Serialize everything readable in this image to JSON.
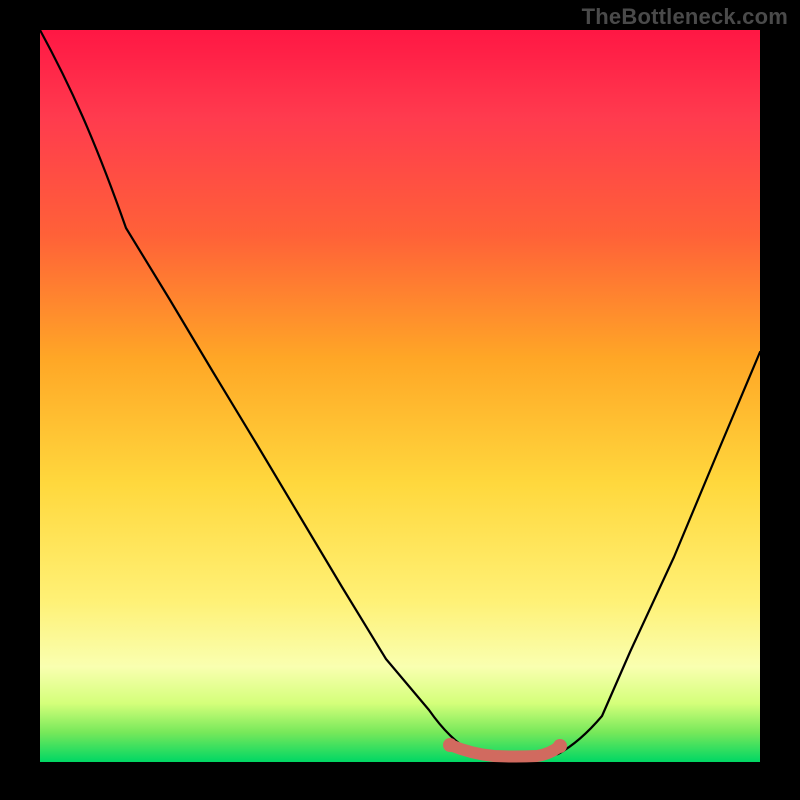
{
  "watermark": "TheBottleneck.com",
  "colors": {
    "background": "#000000",
    "watermark_text": "#4a4a4a",
    "curve_stroke": "#000000",
    "optimal_marker": "#d16a5f",
    "gradient_top": "#ff1744",
    "gradient_mid1": "#ffa726",
    "gradient_mid2": "#ffd83d",
    "gradient_bottom": "#00d764"
  },
  "chart_data": {
    "type": "line",
    "title": "",
    "xlabel": "",
    "ylabel": "",
    "xlim": [
      0,
      100
    ],
    "ylim": [
      0,
      100
    ],
    "grid": false,
    "legend": false,
    "annotations": [
      "TheBottleneck.com"
    ],
    "series": [
      {
        "name": "bottleneck-curve",
        "x": [
          0,
          6,
          12,
          18,
          24,
          30,
          36,
          42,
          48,
          54,
          57,
          60,
          63,
          66,
          69,
          72,
          76,
          82,
          88,
          94,
          100
        ],
        "y": [
          100,
          92,
          83,
          73,
          63,
          53,
          43,
          33,
          23,
          13,
          7,
          3,
          1,
          0.5,
          0.5,
          1,
          5,
          15,
          28,
          42,
          56
        ]
      },
      {
        "name": "optimal-range-marker",
        "x": [
          57,
          60,
          63,
          66,
          69,
          72
        ],
        "y": [
          2.3,
          1.4,
          1.0,
          1.0,
          1.2,
          2.2
        ]
      }
    ]
  }
}
